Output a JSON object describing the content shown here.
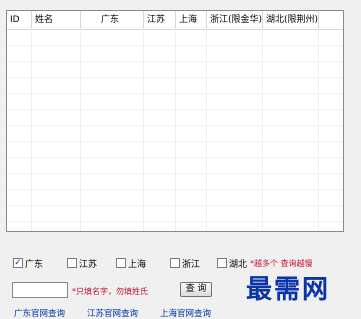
{
  "table": {
    "columns": [
      "ID",
      "姓名",
      "广东",
      "江苏",
      "上海",
      "浙江(限金华)",
      "湖北(限荆州)"
    ]
  },
  "checkboxes": [
    {
      "label": "广东",
      "checked": true
    },
    {
      "label": "江苏",
      "checked": false
    },
    {
      "label": "上海",
      "checked": false
    },
    {
      "label": "浙江",
      "checked": false
    },
    {
      "label": "湖北",
      "checked": false
    }
  ],
  "checkbox_note": "*越多个 查询越慢",
  "search": {
    "value": "",
    "note": "*只填名字，勿填姓氏",
    "button_label": "查 询"
  },
  "links": [
    "广东官网查询",
    "江苏官网查询",
    "上海官网查询"
  ],
  "watermark": "最需网",
  "colors": {
    "note": "#c8102e",
    "link": "#0033aa",
    "watermark": "#0a35a8"
  }
}
